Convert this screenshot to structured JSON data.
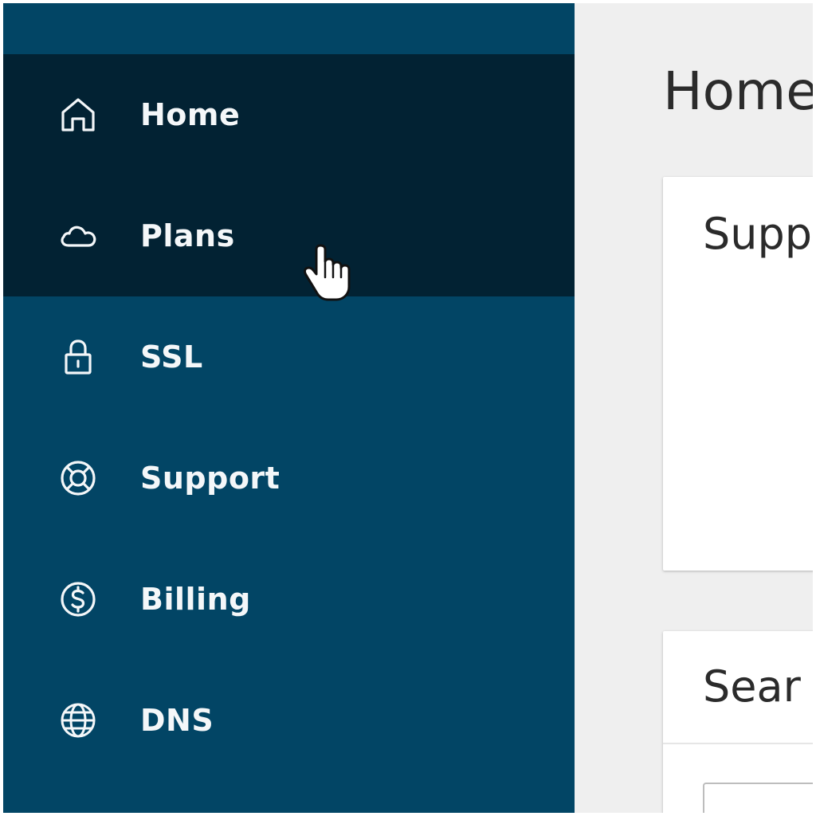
{
  "sidebar": {
    "items": [
      {
        "label": "Home",
        "icon": "home-icon",
        "active": true
      },
      {
        "label": "Plans",
        "icon": "cloud-icon",
        "active": true
      },
      {
        "label": "SSL",
        "icon": "lock-icon",
        "active": false
      },
      {
        "label": "Support",
        "icon": "lifebuoy-icon",
        "active": false
      },
      {
        "label": "Billing",
        "icon": "dollar-circle-icon",
        "active": false
      },
      {
        "label": "DNS",
        "icon": "globe-icon",
        "active": false
      }
    ]
  },
  "main": {
    "title": "Home",
    "cards": [
      {
        "title": "Supp"
      },
      {
        "title": "Sear"
      }
    ]
  },
  "colors": {
    "sidebar_bg": "#024565",
    "sidebar_active_bg": "#022233",
    "main_bg": "#efefef",
    "nav_text": "#f4f7f9"
  }
}
